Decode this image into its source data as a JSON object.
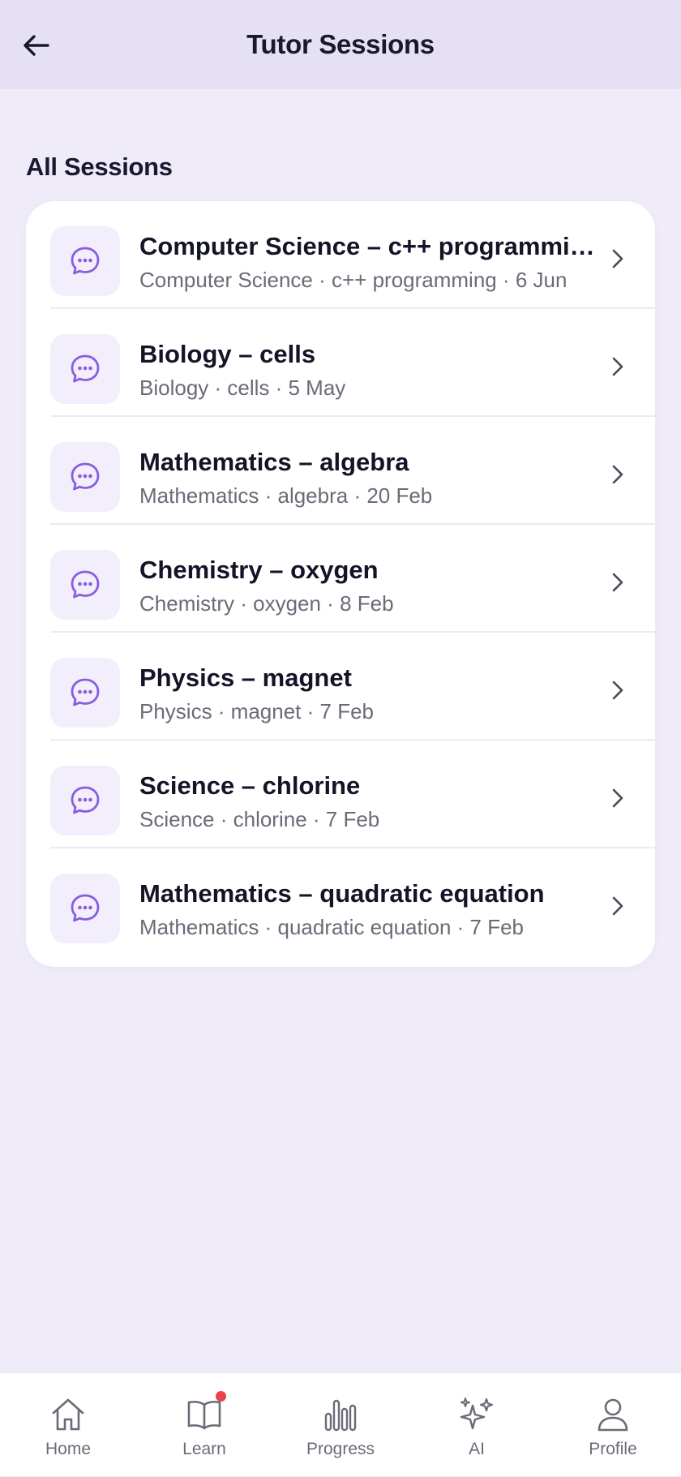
{
  "header": {
    "title": "Tutor Sessions"
  },
  "section": {
    "title": "All Sessions"
  },
  "sessions": [
    {
      "title": "Computer Science – c++ programmi…",
      "subtitle": "Computer Science · c++ programming · 6 Jun"
    },
    {
      "title": "Biology – cells",
      "subtitle": "Biology · cells · 5 May"
    },
    {
      "title": "Mathematics – algebra",
      "subtitle": "Mathematics · algebra · 20 Feb"
    },
    {
      "title": "Chemistry – oxygen",
      "subtitle": "Chemistry · oxygen · 8 Feb"
    },
    {
      "title": "Physics – magnet",
      "subtitle": "Physics · magnet · 7 Feb"
    },
    {
      "title": "Science – chlorine",
      "subtitle": "Science · chlorine · 7 Feb"
    },
    {
      "title": "Mathematics – quadratic equation",
      "subtitle": "Mathematics · quadratic equation · 7 Feb"
    }
  ],
  "tabs": [
    {
      "label": "Home",
      "icon": "home-icon"
    },
    {
      "label": "Learn",
      "icon": "book-icon",
      "badge": true
    },
    {
      "label": "Progress",
      "icon": "bar-chart-icon"
    },
    {
      "label": "AI",
      "icon": "sparkles-icon"
    },
    {
      "label": "Profile",
      "icon": "user-icon"
    }
  ],
  "colors": {
    "accent": "#8a5ce0",
    "background": "#efebf9",
    "header": "#e6e0f4",
    "badge": "#e8424a"
  }
}
